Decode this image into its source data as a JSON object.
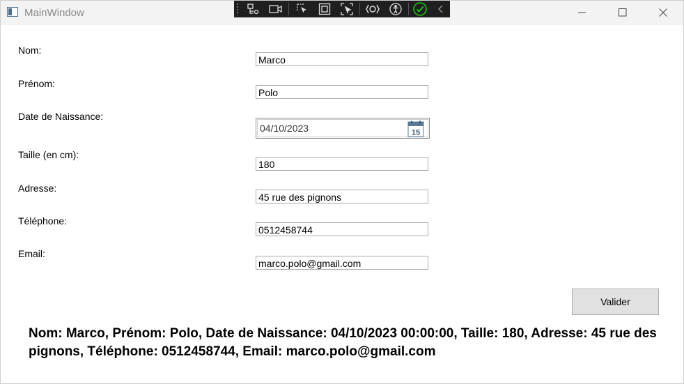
{
  "window": {
    "title": "MainWindow",
    "controls": {
      "minimize_icon": "minimize-icon",
      "maximize_icon": "maximize-icon",
      "close_icon": "close-icon"
    }
  },
  "devtools": {
    "tools": [
      "live-visual-tree-icon",
      "select-element-icon",
      "display-layout-adorners-icon",
      "track-focus-icon",
      "binding-failures-icon",
      "accessibility-checker-icon",
      "hot-reload-ok-icon",
      "collapse-icon"
    ]
  },
  "form": {
    "nom": {
      "label": "Nom:",
      "value": "Marco"
    },
    "prenom": {
      "label": "Prénom:",
      "value": "Polo"
    },
    "date_naissance": {
      "label": "Date de Naissance:",
      "value": "04/10/2023",
      "calendar_day": "15"
    },
    "taille": {
      "label": "Taille (en cm):",
      "value": "180"
    },
    "adresse": {
      "label": "Adresse:",
      "value": "45 rue des pignons"
    },
    "telephone": {
      "label": "Téléphone:",
      "value": "0512458744"
    },
    "email": {
      "label": "Email:",
      "value": "marco.polo@gmail.com"
    }
  },
  "submit_label": "Valider",
  "result_text": "Nom: Marco, Prénom: Polo, Date de Naissance: 04/10/2023 00:00:00, Taille: 180, Adresse: 45 rue des pignons, Téléphone: 0512458744, Email: marco.polo@gmail.com",
  "colors": {
    "accent_check": "#16c60c",
    "button_bg": "#e1e1e1",
    "devbar_bg": "#1f1f1f"
  }
}
